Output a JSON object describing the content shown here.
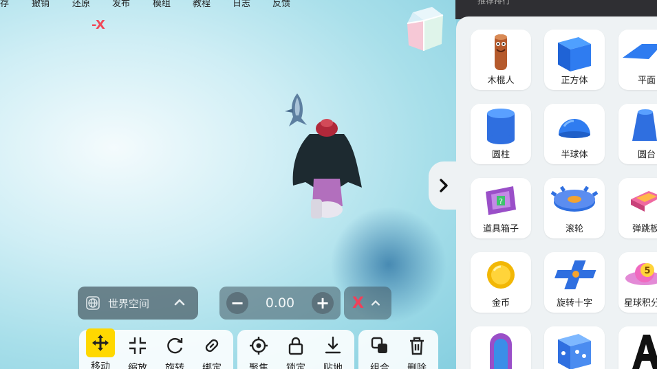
{
  "menu": [
    "存",
    "撤销",
    "还原",
    "发布",
    "模组",
    "教程",
    "日志",
    "反馈"
  ],
  "top_right_hint": "推荐排行",
  "gizmo_axis_label": "-X",
  "space_selector": {
    "label": "世界空间"
  },
  "value_stepper": {
    "minus": "−",
    "value": "0.00",
    "plus": "+"
  },
  "axis_selector": {
    "label": "X"
  },
  "tools": {
    "transform": [
      "移动",
      "缩放",
      "旋转",
      "绑定"
    ],
    "placement": [
      "聚焦",
      "锁定",
      "贴地"
    ],
    "edit": [
      "组合",
      "删除"
    ]
  },
  "assets": [
    {
      "name": "木棍人",
      "icon": "stick-man"
    },
    {
      "name": "正方体",
      "icon": "cube"
    },
    {
      "name": "平面",
      "icon": "plane"
    },
    {
      "name": "圆柱",
      "icon": "cylinder"
    },
    {
      "name": "半球体",
      "icon": "hemisphere"
    },
    {
      "name": "圆台",
      "icon": "frustum"
    },
    {
      "name": "道具箱子",
      "icon": "item-box"
    },
    {
      "name": "滚轮",
      "icon": "gear-roller"
    },
    {
      "name": "弹跳板",
      "icon": "bounce-pad"
    },
    {
      "name": "金币",
      "icon": "coin"
    },
    {
      "name": "旋转十字",
      "icon": "rotating-cross"
    },
    {
      "name": "星球积分",
      "icon": "planet-score"
    },
    {
      "name": "",
      "icon": "portal"
    },
    {
      "name": "",
      "icon": "dice-cube"
    },
    {
      "name": "",
      "icon": "letter-a"
    }
  ],
  "colors": {
    "accent": "#ffd800",
    "axis_x": "#f0405a",
    "panel_bg": "#eef2f4"
  }
}
